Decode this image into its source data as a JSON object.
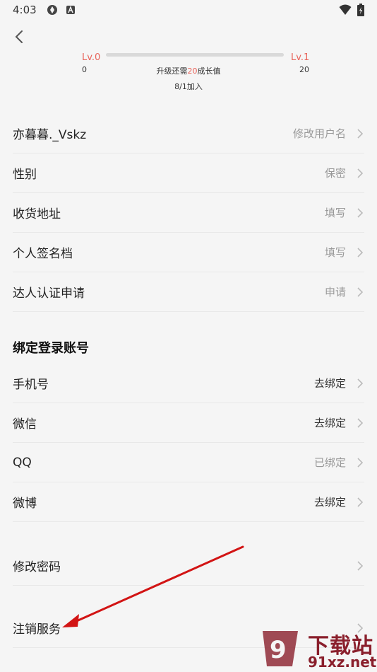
{
  "status_bar": {
    "time": "4:03",
    "icons_left": [
      "notification-icon",
      "a-icon"
    ],
    "icons_right": [
      "wifi-icon",
      "battery-icon"
    ]
  },
  "level": {
    "left_label": "Lv.0",
    "right_label": "Lv.1",
    "left_value": "0",
    "right_value": "20",
    "need_prefix": "升级还需",
    "need_amount": "20",
    "need_suffix": "成长值",
    "joined": "8/1加入",
    "progress": 0,
    "accent": "#e8635a"
  },
  "profile_rows": [
    {
      "label": "亦暮暮._Vskz",
      "value": "修改用户名"
    },
    {
      "label": "性别",
      "value": "保密"
    },
    {
      "label": "收货地址",
      "value": "填写"
    },
    {
      "label": "个人签名档",
      "value": "填写"
    },
    {
      "label": "达人认证申请",
      "value": "申请"
    }
  ],
  "bind_section": {
    "title": "绑定登录账号",
    "rows": [
      {
        "label": "手机号",
        "value": "去绑定"
      },
      {
        "label": "微信",
        "value": "去绑定"
      },
      {
        "label": "QQ",
        "value": "已绑定"
      },
      {
        "label": "微博",
        "value": "去绑定"
      }
    ]
  },
  "other_rows": [
    {
      "label": "修改密码",
      "value": ""
    },
    {
      "label": "注销服务",
      "value": ""
    }
  ],
  "watermark": {
    "line1": "下载站",
    "line2": "91xz.net"
  }
}
